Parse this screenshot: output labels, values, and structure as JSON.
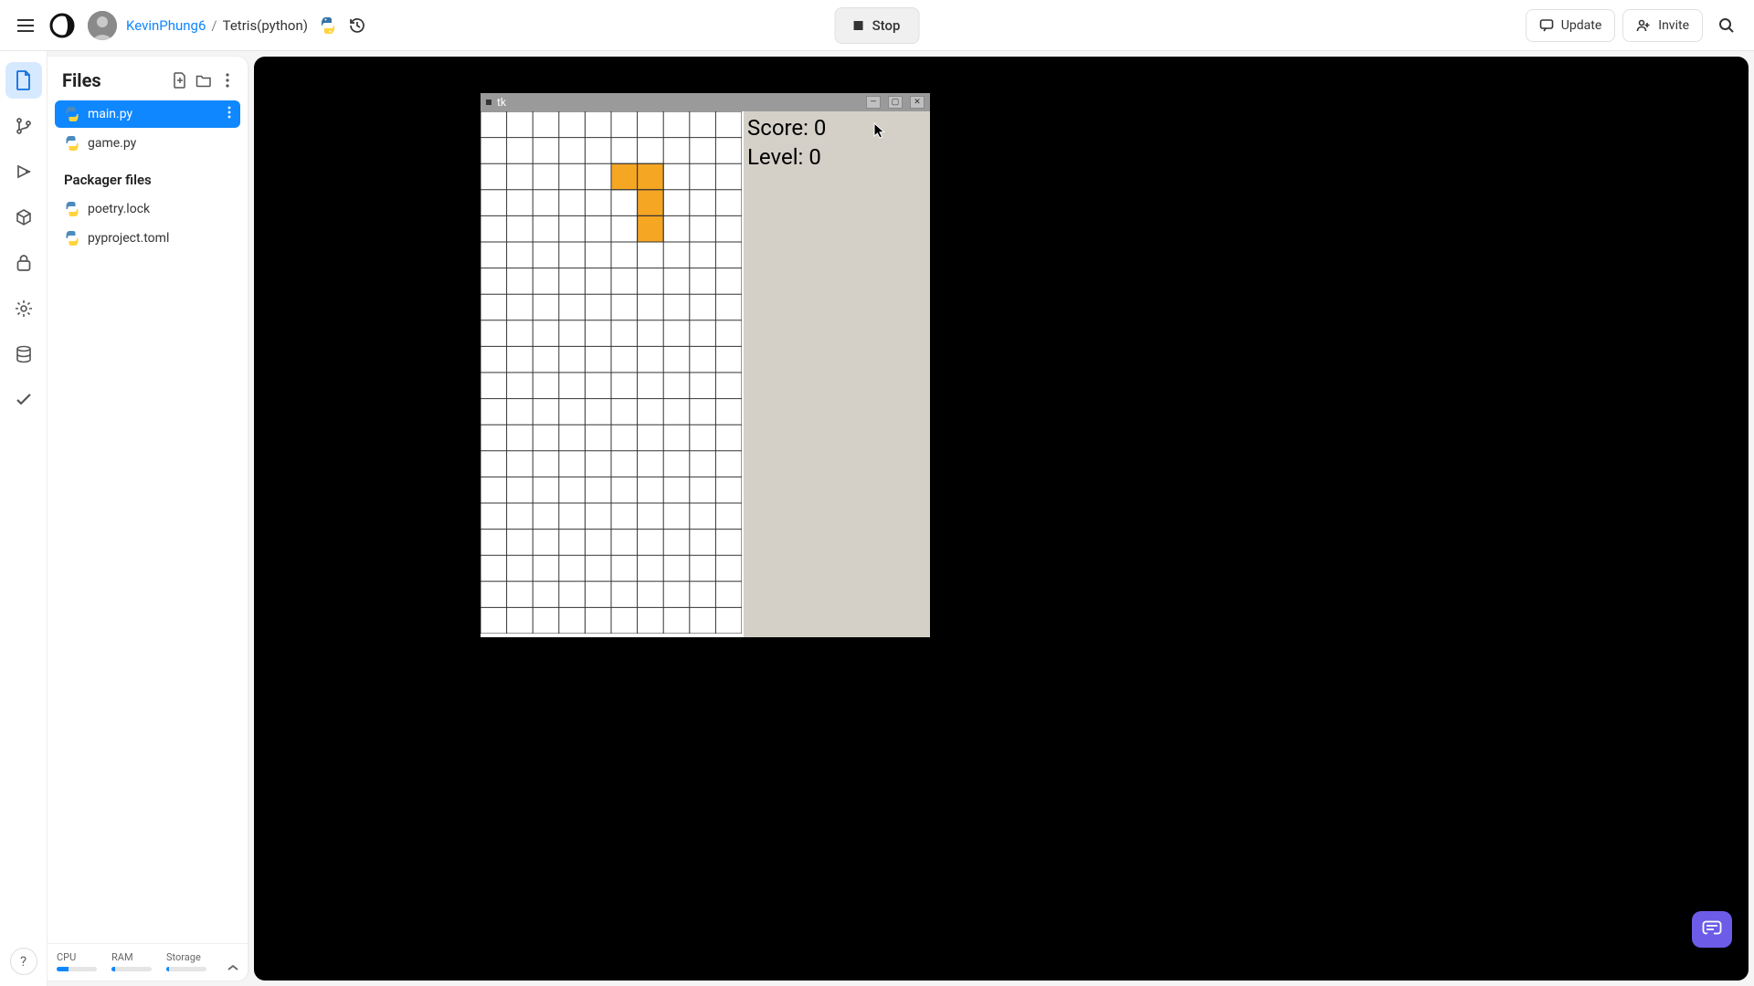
{
  "header": {
    "user": "KevinPhung6",
    "sep": "/",
    "project": "Tetris(python)",
    "run_label": "Stop",
    "update_label": "Update",
    "invite_label": "Invite"
  },
  "files": {
    "title": "Files",
    "items": [
      {
        "name": "main.py",
        "selected": true
      },
      {
        "name": "game.py",
        "selected": false
      }
    ],
    "packager_label": "Packager files",
    "packager_items": [
      {
        "name": "poetry.lock"
      },
      {
        "name": "pyproject.toml"
      }
    ]
  },
  "stats": {
    "cpu_label": "CPU",
    "ram_label": "RAM",
    "storage_label": "Storage",
    "cpu_pct": 30,
    "ram_pct": 10,
    "storage_pct": 6
  },
  "game": {
    "window_title": "tk",
    "score_label": "Score: ",
    "score_value": "0",
    "level_label": "Level: ",
    "level_value": "0",
    "grid": {
      "cols": 10,
      "rows": 20,
      "cell": 28.6
    },
    "piece_color": "#f5a623",
    "piece_cells": [
      {
        "c": 5,
        "r": 2
      },
      {
        "c": 6,
        "r": 2
      },
      {
        "c": 6,
        "r": 3
      },
      {
        "c": 6,
        "r": 4
      }
    ]
  },
  "help_label": "?"
}
